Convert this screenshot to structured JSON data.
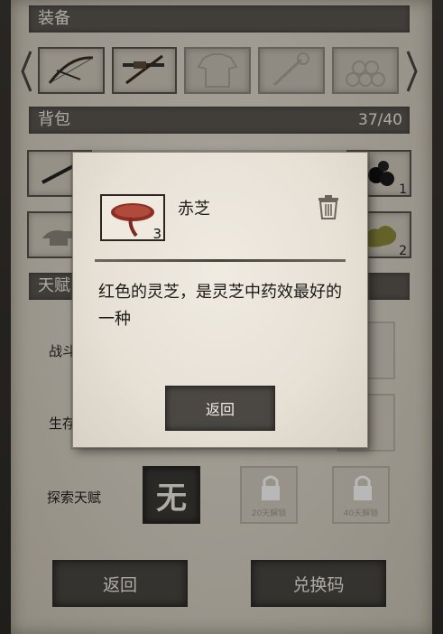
{
  "equipment": {
    "title": "装备"
  },
  "backpack": {
    "title": "背包",
    "capacity": "37/40",
    "slot_counts": {
      "black_beads": "1",
      "herb": "2"
    }
  },
  "talents": {
    "title": "天赋",
    "rows": [
      {
        "label": "战斗天赋"
      },
      {
        "label": "生存天赋"
      },
      {
        "label": "探索天赋",
        "value": "无",
        "locks": [
          "20天解锁",
          "40天解锁"
        ]
      }
    ]
  },
  "buttons": {
    "back": "返回",
    "redeem": "兑换码"
  },
  "modal": {
    "item_name": "赤芝",
    "item_count": "3",
    "description": "红色的灵芝，是灵芝中药效最好的一种",
    "back_button": "返回"
  },
  "colors": {
    "panel": "#d9d3c6",
    "header": "#5a5650",
    "button": "#4a4743",
    "accent_red": "#8b2f25"
  }
}
